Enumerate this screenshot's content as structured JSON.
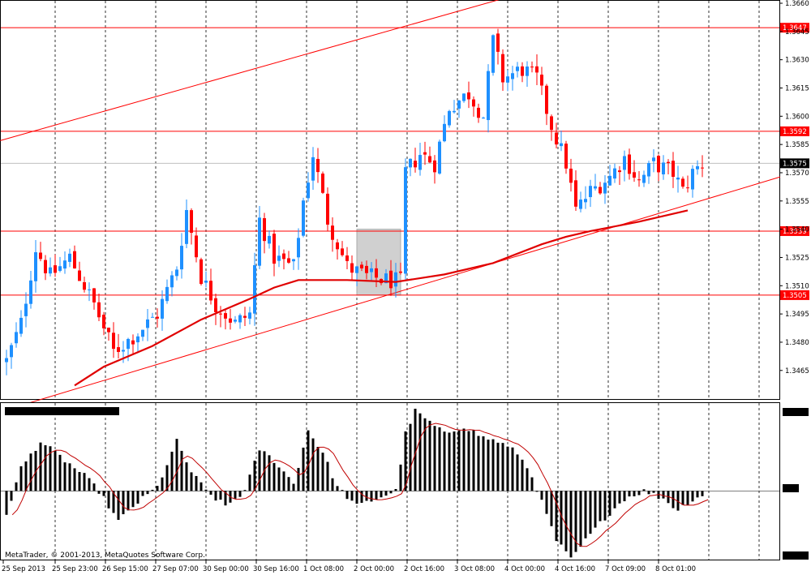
{
  "copyright": "MetaTrader, © 2001-2013, MetaQuotes Software Corp.",
  "chart_data": {
    "type": "candlestick",
    "price_axis": {
      "min": 1.3455,
      "max": 1.366,
      "ticks": [
        "1.3465",
        "1.3480",
        "1.3495",
        "1.3510",
        "1.3525",
        "1.3540",
        "1.3555",
        "1.3570",
        "1.3585",
        "1.3600",
        "1.3615",
        "1.3630",
        "1.3645",
        "1.3660"
      ]
    },
    "time_axis": {
      "labels": [
        "25 Sep 2013",
        "25 Sep 23:00",
        "26 Sep 15:00",
        "27 Sep 07:00",
        "30 Sep 00:00",
        "30 Sep 16:00",
        "1 Oct 08:00",
        "2 Oct 00:00",
        "2 Oct 16:00",
        "3 Oct 08:00",
        "4 Oct 00:00",
        "4 Oct 16:00",
        "7 Oct 09:00",
        "8 Oct 01:00"
      ]
    },
    "horizontal_levels": [
      {
        "value": 1.3647,
        "label": "1.3647"
      },
      {
        "value": 1.3592,
        "label": "1.3592"
      },
      {
        "value": 1.3539,
        "label": "1.3539"
      },
      {
        "value": 1.3505,
        "label": "1.3505"
      }
    ],
    "current_price": {
      "value": 1.3575,
      "label": "1.3575"
    },
    "trend_channel": {
      "upper": [
        {
          "bar": 0,
          "price": 1.3588
        },
        {
          "bar": 100,
          "price": 1.3661
        }
      ],
      "lower": [
        {
          "bar": 14,
          "price": 1.3455
        },
        {
          "bar": 140,
          "price": 1.3553
        }
      ]
    },
    "moving_average": [
      {
        "bar": 14,
        "price": 1.3457
      },
      {
        "bar": 20,
        "price": 1.3467
      },
      {
        "bar": 30,
        "price": 1.3478
      },
      {
        "bar": 40,
        "price": 1.3492
      },
      {
        "bar": 50,
        "price": 1.3503
      },
      {
        "bar": 55,
        "price": 1.3509
      },
      {
        "bar": 60,
        "price": 1.3513
      },
      {
        "bar": 70,
        "price": 1.3513
      },
      {
        "bar": 80,
        "price": 1.3512
      },
      {
        "bar": 90,
        "price": 1.3516
      },
      {
        "bar": 100,
        "price": 1.3522
      },
      {
        "bar": 110,
        "price": 1.3532
      },
      {
        "bar": 115,
        "price": 1.3536
      },
      {
        "bar": 120,
        "price": 1.3539
      },
      {
        "bar": 130,
        "price": 1.3544
      },
      {
        "bar": 140,
        "price": 1.355
      }
    ],
    "highlight_box": {
      "bar_from": 72,
      "bar_to": 81,
      "price_high": 1.354,
      "price_low": 1.3505
    },
    "ohlc_keypoints": [
      [
        0,
        1.347
      ],
      [
        3,
        1.349
      ],
      [
        6,
        1.353
      ],
      [
        9,
        1.3515
      ],
      [
        13,
        1.3525
      ],
      [
        18,
        1.35
      ],
      [
        22,
        1.3475
      ],
      [
        27,
        1.3485
      ],
      [
        31,
        1.3495
      ],
      [
        35,
        1.352
      ],
      [
        37,
        1.355
      ],
      [
        40,
        1.3515
      ],
      [
        43,
        1.35
      ],
      [
        47,
        1.349
      ],
      [
        50,
        1.3495
      ],
      [
        52,
        1.3545
      ],
      [
        55,
        1.3525
      ],
      [
        59,
        1.352
      ],
      [
        61,
        1.3555
      ],
      [
        63,
        1.358
      ],
      [
        66,
        1.3545
      ],
      [
        70,
        1.352
      ],
      [
        74,
        1.3515
      ],
      [
        78,
        1.3513
      ],
      [
        81,
        1.3512
      ],
      [
        82,
        1.357
      ],
      [
        85,
        1.358
      ],
      [
        88,
        1.3575
      ],
      [
        91,
        1.3605
      ],
      [
        95,
        1.3612
      ],
      [
        98,
        1.36
      ],
      [
        100,
        1.364
      ],
      [
        102,
        1.362
      ],
      [
        106,
        1.3625
      ],
      [
        109,
        1.362
      ],
      [
        112,
        1.3595
      ],
      [
        115,
        1.3575
      ],
      [
        117,
        1.355
      ],
      [
        120,
        1.356
      ],
      [
        124,
        1.3568
      ],
      [
        127,
        1.3578
      ],
      [
        130,
        1.3565
      ],
      [
        133,
        1.3575
      ],
      [
        137,
        1.357
      ],
      [
        139,
        1.356
      ],
      [
        141,
        1.357
      ],
      [
        143,
        1.3575
      ]
    ],
    "macd": {
      "min": -0.0018,
      "max": 0.0022,
      "keypoints": [
        [
          0,
          -0.0006
        ],
        [
          3,
          0.0006
        ],
        [
          7,
          0.0013
        ],
        [
          10,
          0.001
        ],
        [
          16,
          0.0004
        ],
        [
          19,
          0.0
        ],
        [
          23,
          -0.0008
        ],
        [
          26,
          -0.0004
        ],
        [
          31,
          0.0001
        ],
        [
          35,
          0.0013
        ],
        [
          38,
          0.0005
        ],
        [
          41,
          0.0
        ],
        [
          45,
          -0.0004
        ],
        [
          49,
          0.0
        ],
        [
          52,
          0.0011
        ],
        [
          55,
          0.0008
        ],
        [
          59,
          0.0002
        ],
        [
          62,
          0.0016
        ],
        [
          65,
          0.001
        ],
        [
          68,
          0.0001
        ],
        [
          72,
          -0.0004
        ],
        [
          76,
          -0.0002
        ],
        [
          80,
          0.0
        ],
        [
          82,
          0.0015
        ],
        [
          84,
          0.0021
        ],
        [
          87,
          0.0018
        ],
        [
          90,
          0.0015
        ],
        [
          94,
          0.0017
        ],
        [
          98,
          0.0014
        ],
        [
          101,
          0.0013
        ],
        [
          105,
          0.001
        ],
        [
          108,
          0.0004
        ],
        [
          110,
          -0.0003
        ],
        [
          113,
          -0.0013
        ],
        [
          116,
          -0.0018
        ],
        [
          119,
          -0.0013
        ],
        [
          123,
          -0.0007
        ],
        [
          127,
          -0.0002
        ],
        [
          131,
          0.0
        ],
        [
          135,
          -0.0002
        ],
        [
          138,
          -0.0005
        ],
        [
          140,
          -0.0003
        ],
        [
          143,
          -0.0001
        ]
      ]
    }
  }
}
